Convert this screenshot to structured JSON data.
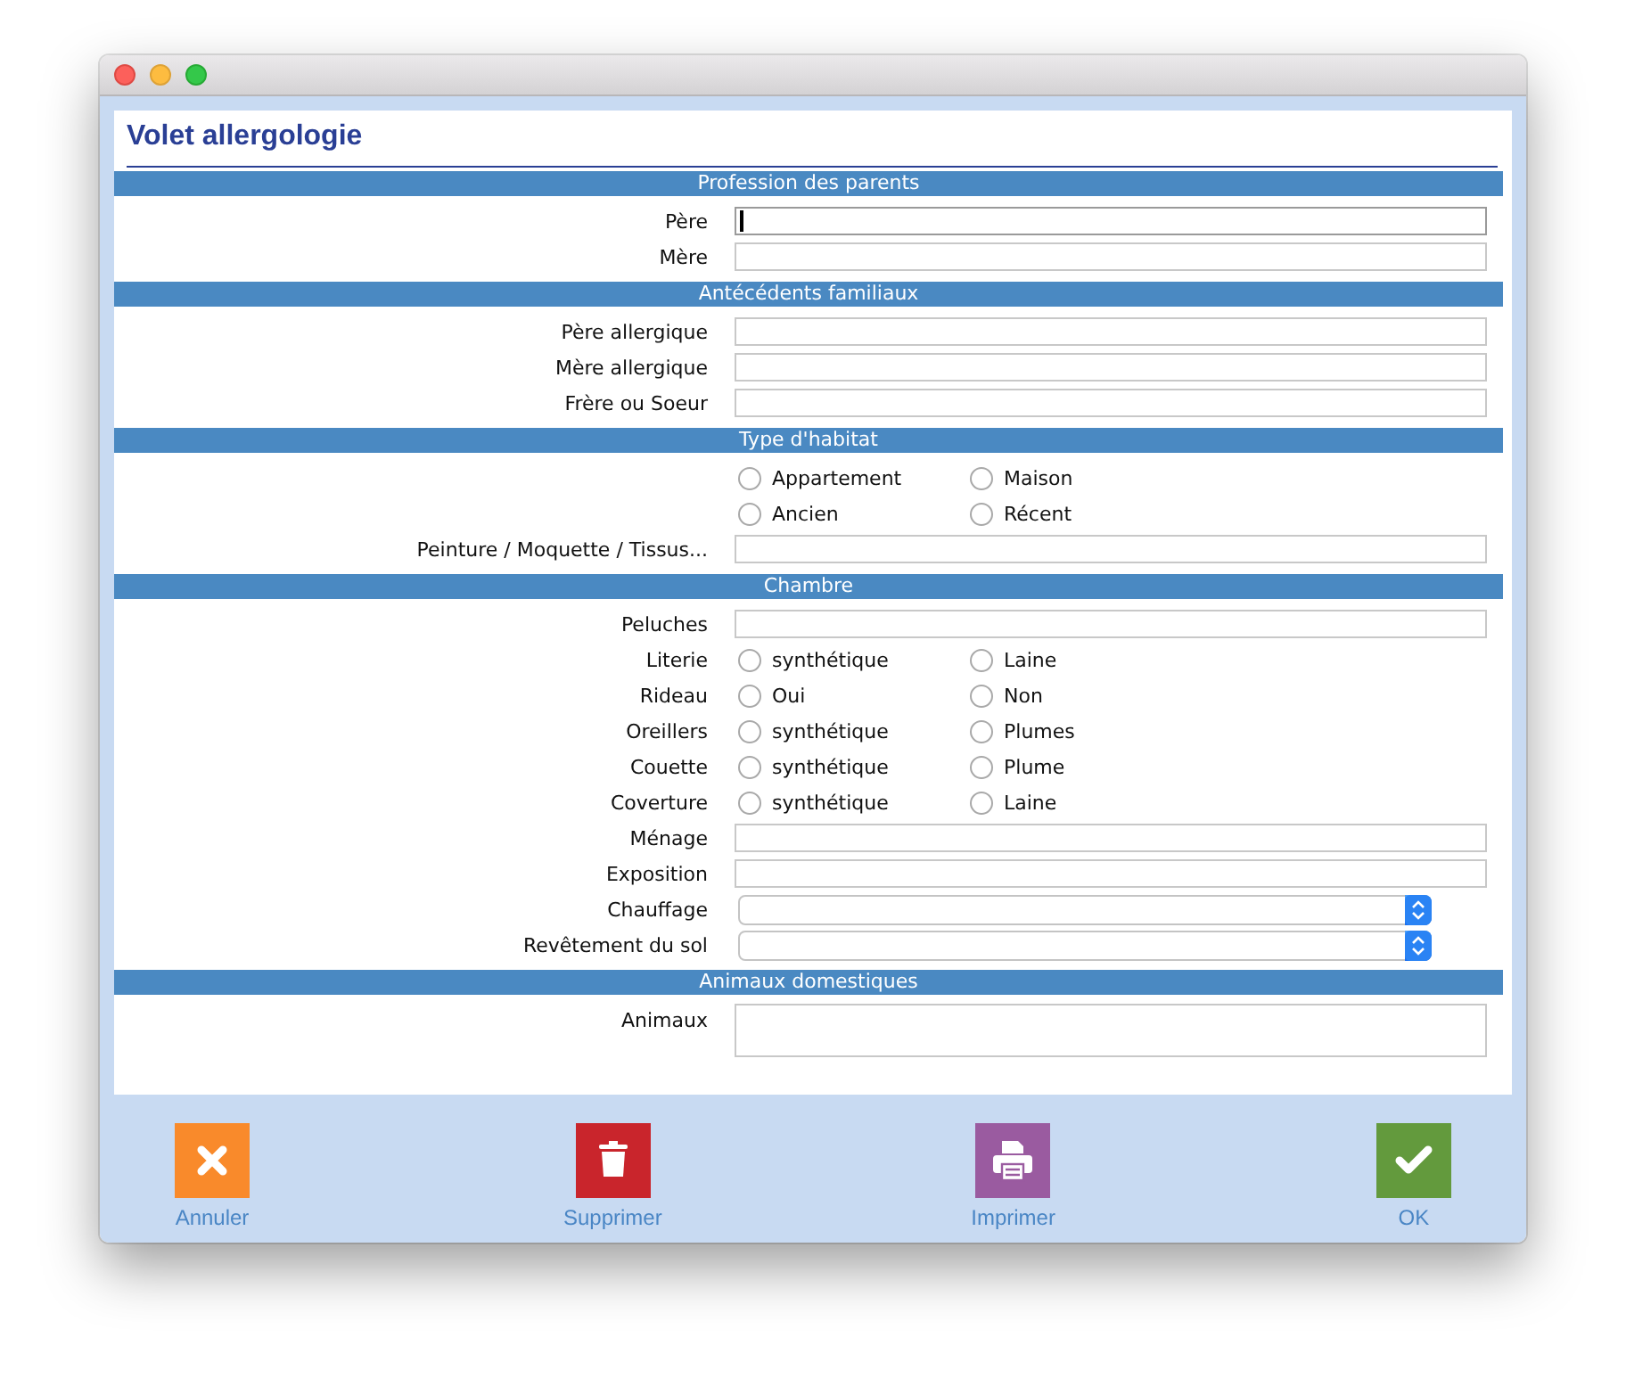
{
  "window": {
    "title": "Volet allergologie"
  },
  "sections": [
    {
      "title": "Profession des parents",
      "rows": [
        {
          "kind": "text",
          "label": "Père",
          "focused": true
        },
        {
          "kind": "text",
          "label": "Mère",
          "focused": false
        }
      ]
    },
    {
      "title": "Antécédents familiaux",
      "rows": [
        {
          "kind": "text",
          "label": "Père allergique",
          "focused": false
        },
        {
          "kind": "text",
          "label": "Mère allergique",
          "focused": false
        },
        {
          "kind": "text",
          "label": "Frère ou Soeur",
          "focused": false
        }
      ]
    },
    {
      "title": "Type d'habitat",
      "rows": [
        {
          "kind": "radio",
          "options": [
            {
              "label": "Appartement",
              "selected": false
            },
            {
              "label": "Maison",
              "selected": false
            }
          ]
        },
        {
          "kind": "radio",
          "options": [
            {
              "label": "Ancien",
              "selected": false
            },
            {
              "label": "Récent",
              "selected": false
            }
          ]
        },
        {
          "kind": "text",
          "label": "Peinture / Moquette / Tissus...",
          "focused": false
        }
      ]
    },
    {
      "title": "Chambre",
      "rows": [
        {
          "kind": "text",
          "label": "Peluches",
          "focused": false
        },
        {
          "kind": "radio",
          "label": "Literie",
          "options": [
            {
              "label": "synthétique",
              "selected": false
            },
            {
              "label": "Laine",
              "selected": false
            }
          ]
        },
        {
          "kind": "radio",
          "label": "Rideau",
          "options": [
            {
              "label": "Oui",
              "selected": false
            },
            {
              "label": "Non",
              "selected": false
            }
          ]
        },
        {
          "kind": "radio",
          "label": "Oreillers",
          "options": [
            {
              "label": "synthétique",
              "selected": false
            },
            {
              "label": "Plumes",
              "selected": false
            }
          ]
        },
        {
          "kind": "radio",
          "label": "Couette",
          "options": [
            {
              "label": "synthétique",
              "selected": false
            },
            {
              "label": "Plume",
              "selected": false
            }
          ]
        },
        {
          "kind": "radio",
          "label": "Coverture",
          "options": [
            {
              "label": "synthétique",
              "selected": false
            },
            {
              "label": "Laine",
              "selected": false
            }
          ]
        },
        {
          "kind": "text",
          "label": "Ménage",
          "focused": false
        },
        {
          "kind": "text",
          "label": "Exposition",
          "focused": false
        },
        {
          "kind": "select",
          "label": "Chauffage"
        },
        {
          "kind": "select",
          "label": "Revêtement du sol"
        }
      ]
    },
    {
      "title": "Animaux domestiques",
      "rows": [
        {
          "kind": "textarea",
          "label": "Animaux",
          "focused": false
        }
      ]
    }
  ],
  "buttons": [
    {
      "kind": "cancel",
      "label": "Annuler"
    },
    {
      "kind": "delete",
      "label": "Supprimer"
    },
    {
      "kind": "print",
      "label": "Imprimer"
    },
    {
      "kind": "ok",
      "label": "OK"
    }
  ]
}
